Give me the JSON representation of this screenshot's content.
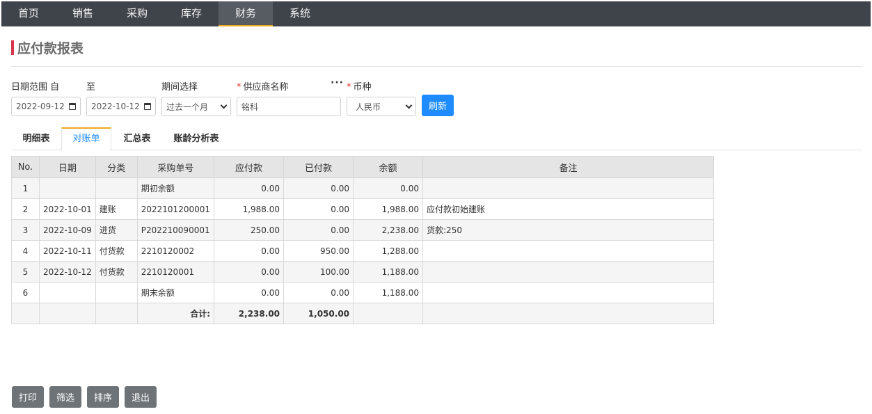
{
  "nav": {
    "items": [
      {
        "label": "首页"
      },
      {
        "label": "销售"
      },
      {
        "label": "采购"
      },
      {
        "label": "库存"
      },
      {
        "label": "财务"
      },
      {
        "label": "系统"
      }
    ],
    "active_index": 4,
    "active_color": "#f0a71c"
  },
  "page": {
    "title": "应付款报表",
    "accent_color": "#d9364c"
  },
  "filters": {
    "date_range_label": "日期范围 自",
    "to_label": "至",
    "date_from": "2022-09-12",
    "date_to": "2022-10-12",
    "period_label": "期间选择",
    "period_value": "过去一个月",
    "supplier_label": "供应商名称",
    "supplier_value": "铭科",
    "more_label": "···",
    "currency_label": "币种",
    "currency_value": "人民币",
    "required_mark": "*",
    "refresh_label": "刷新",
    "refresh_color": "#1e8cff"
  },
  "tabs": [
    {
      "label": "明细表"
    },
    {
      "label": "对账单"
    },
    {
      "label": "汇总表"
    },
    {
      "label": "账龄分析表"
    }
  ],
  "table": {
    "headers": [
      "No.",
      "日期",
      "分类",
      "采购单号",
      "应付款",
      "已付款",
      "余额",
      "备注"
    ],
    "rows": [
      [
        "1",
        "",
        "",
        "期初余额",
        "0.00",
        "0.00",
        "0.00",
        ""
      ],
      [
        "2",
        "2022-10-01",
        "建账",
        "2022101200001",
        "1,988.00",
        "0.00",
        "1,988.00",
        "应付款初始建账"
      ],
      [
        "3",
        "2022-10-09",
        "进货",
        "P202210090001",
        "250.00",
        "0.00",
        "2,238.00",
        "货款:250"
      ],
      [
        "4",
        "2022-10-11",
        "付货款",
        "2210120002",
        "0.00",
        "950.00",
        "1,288.00",
        ""
      ],
      [
        "5",
        "2022-10-12",
        "付货款",
        "2210120001",
        "0.00",
        "100.00",
        "1,188.00",
        ""
      ],
      [
        "6",
        "",
        "",
        "期末余额",
        "0.00",
        "0.00",
        "1,188.00",
        ""
      ]
    ],
    "total": {
      "label": "合计:",
      "payable": "2,238.00",
      "paid": "1,050.00"
    }
  },
  "actions": {
    "print": "打印",
    "filter": "筛选",
    "sort": "排序",
    "exit": "退出"
  }
}
